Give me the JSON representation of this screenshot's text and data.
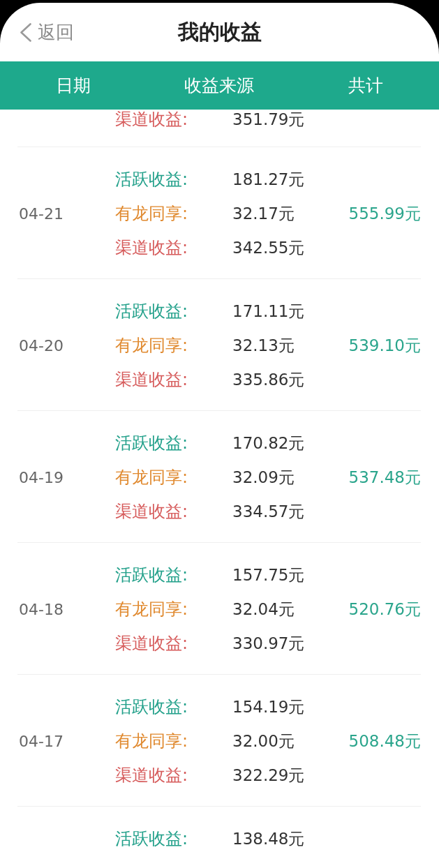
{
  "header": {
    "back_label": "返回",
    "title": "我的收益"
  },
  "table": {
    "columns": [
      "日期",
      "收益来源",
      "共计"
    ],
    "rows": [
      {
        "sources": [
          {
            "label": "渠道收益:",
            "amount": "351.79元",
            "color": "#d65b5b"
          }
        ]
      },
      {
        "date": "04-21",
        "sources": [
          {
            "label": "活跃收益:",
            "amount": "181.27元",
            "color": "#22a08a"
          },
          {
            "label": "有龙同享:",
            "amount": "32.17元",
            "color": "#e08a30"
          },
          {
            "label": "渠道收益:",
            "amount": "342.55元",
            "color": "#d65b5b"
          }
        ],
        "total": "555.99元"
      },
      {
        "date": "04-20",
        "sources": [
          {
            "label": "活跃收益:",
            "amount": "171.11元",
            "color": "#22a08a"
          },
          {
            "label": "有龙同享:",
            "amount": "32.13元",
            "color": "#e08a30"
          },
          {
            "label": "渠道收益:",
            "amount": "335.86元",
            "color": "#d65b5b"
          }
        ],
        "total": "539.10元"
      },
      {
        "date": "04-19",
        "sources": [
          {
            "label": "活跃收益:",
            "amount": "170.82元",
            "color": "#22a08a"
          },
          {
            "label": "有龙同享:",
            "amount": "32.09元",
            "color": "#e08a30"
          },
          {
            "label": "渠道收益:",
            "amount": "334.57元",
            "color": "#d65b5b"
          }
        ],
        "total": "537.48元"
      },
      {
        "date": "04-18",
        "sources": [
          {
            "label": "活跃收益:",
            "amount": "157.75元",
            "color": "#22a08a"
          },
          {
            "label": "有龙同享:",
            "amount": "32.04元",
            "color": "#e08a30"
          },
          {
            "label": "渠道收益:",
            "amount": "330.97元",
            "color": "#d65b5b"
          }
        ],
        "total": "520.76元"
      },
      {
        "date": "04-17",
        "sources": [
          {
            "label": "活跃收益:",
            "amount": "154.19元",
            "color": "#22a08a"
          },
          {
            "label": "有龙同享:",
            "amount": "32.00元",
            "color": "#e08a30"
          },
          {
            "label": "渠道收益:",
            "amount": "322.29元",
            "color": "#d65b5b"
          }
        ],
        "total": "508.48元"
      },
      {
        "sources": [
          {
            "label": "活跃收益:",
            "amount": "138.48元",
            "color": "#22a08a"
          }
        ]
      }
    ]
  }
}
